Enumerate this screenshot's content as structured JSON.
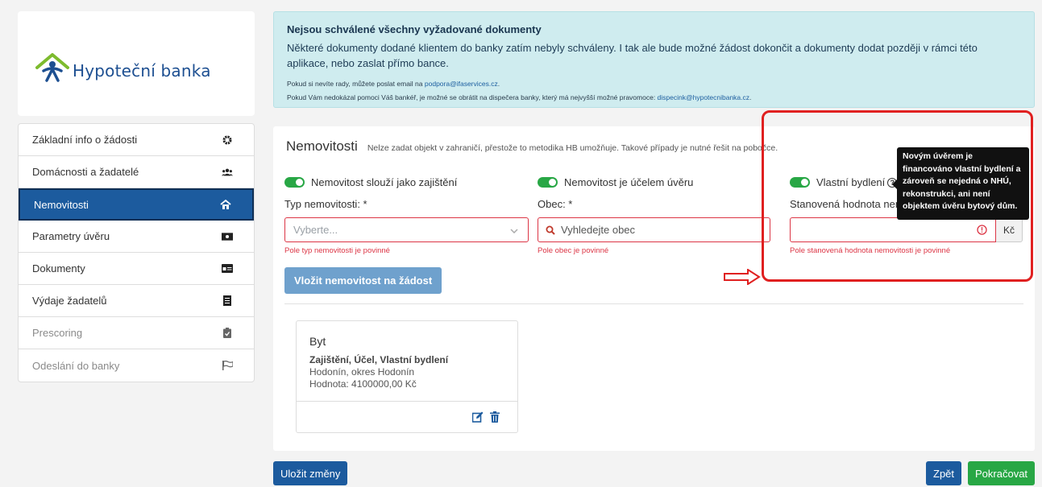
{
  "brand": {
    "name": "Hypoteční banka",
    "logo_icon": "house-person-icon"
  },
  "sidebar": {
    "items": [
      {
        "label": "Základní info o žádosti",
        "icon": "gear-icon",
        "state": "normal"
      },
      {
        "label": "Domácnosti a žadatelé",
        "icon": "users-icon",
        "state": "normal"
      },
      {
        "label": "Nemovitosti",
        "icon": "home-icon",
        "state": "active"
      },
      {
        "label": "Parametry úvěru",
        "icon": "money-icon",
        "state": "normal"
      },
      {
        "label": "Dokumenty",
        "icon": "id-card-icon",
        "state": "normal"
      },
      {
        "label": "Výdaje žadatelů",
        "icon": "receipt-icon",
        "state": "normal"
      },
      {
        "label": "Prescoring",
        "icon": "clipboard-check-icon",
        "state": "disabled"
      },
      {
        "label": "Odeslání do banky",
        "icon": "flag-icon",
        "state": "disabled"
      }
    ]
  },
  "alert": {
    "title": "Nejsou schválené všechny vyžadované dokumenty",
    "body": "Některé dokumenty dodané klientem do banky zatím nebyly schváleny. I tak ale bude možné žádost dokončit a dokumenty dodat později v rámci této aplikace, nebo zaslat přímo bance.",
    "help1_prefix": "Pokud si nevíte rady, můžete poslat email na ",
    "help1_email": "podpora@ifaservices.cz",
    "help1_suffix": ".",
    "help2_prefix": "Pokud Vám nedokázal pomoci Váš bankéř, je možné se obrátit na dispečera banky, který má nejvyšší možné pravomoce: ",
    "help2_email": "dispecink@hypotecnibanka.cz",
    "help2_suffix": "."
  },
  "section": {
    "title": "Nemovitosti",
    "subtitle": "Nelze zadat objekt v zahraničí, přestože to metodika HB umožňuje. Takové případy je nutné řešit na pobočce.",
    "col1": {
      "toggle_label": "Nemovitost slouží jako zajištění",
      "field_label": "Typ nemovitosti: *",
      "placeholder": "Vyberte...",
      "error": "Pole typ nemovitosti je povinné"
    },
    "col2": {
      "toggle_label": "Nemovitost je účelem úvěru",
      "field_label": "Obec: *",
      "placeholder": "Vyhledejte obec",
      "error": "Pole obec je povinné"
    },
    "col3": {
      "toggle_label": "Vlastní bydlení",
      "help_glyph": "?",
      "field_label": "Stanovená hodnota nem",
      "currency": "Kč",
      "error": "Pole stanovená hodnota nemovitosti je povinné"
    },
    "insert_button": "Vložit nemovitost na žádost",
    "tooltip": "Novým úvěrem je financováno vlastní bydlení a zároveň se nejedná o NHÚ, rekonstrukci, ani není objektem úvěru bytový dům.",
    "property": {
      "type": "Byt",
      "tags": "Zajištění, Účel, Vlastní bydlení",
      "location": "Hodonín, okres Hodonín",
      "value": "Hodnota: 4100000,00 Kč"
    }
  },
  "footer": {
    "save": "Uložit změny",
    "back": "Zpět",
    "next": "Pokračovat"
  },
  "colors": {
    "primary": "#1c5b9e",
    "success": "#28a745",
    "danger": "#dc3545",
    "alert_bg": "#cfecef",
    "annotation": "#e02020"
  }
}
